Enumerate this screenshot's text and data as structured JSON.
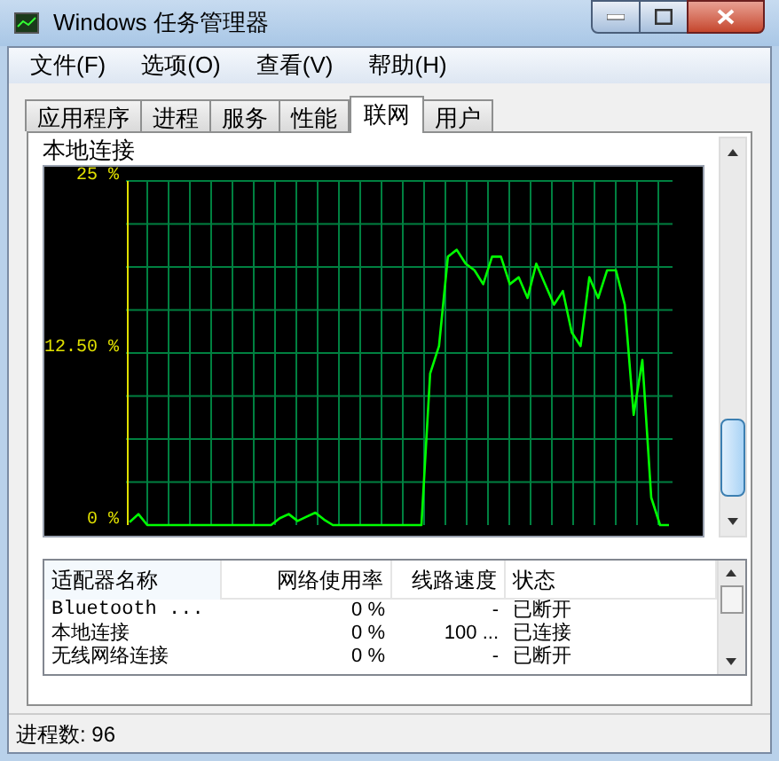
{
  "window": {
    "title": "Windows 任务管理器"
  },
  "menu": [
    "文件(F)",
    "选项(O)",
    "查看(V)",
    "帮助(H)"
  ],
  "tabs": [
    {
      "label": "应用程序",
      "selected": false
    },
    {
      "label": "进程",
      "selected": false
    },
    {
      "label": "服务",
      "selected": false
    },
    {
      "label": "性能",
      "selected": false
    },
    {
      "label": "联网",
      "selected": true
    },
    {
      "label": "用户",
      "selected": false
    }
  ],
  "graph": {
    "title": "本地连接",
    "chart_data": {
      "type": "line",
      "ylim": [
        0,
        25
      ],
      "yticks": [
        {
          "value": 0,
          "label": "0 %"
        },
        {
          "value": 12.5,
          "label": "12.50 %"
        },
        {
          "value": 25,
          "label": "25 %"
        }
      ],
      "grid": true,
      "series": [
        {
          "color": "#00ff00",
          "values": [
            0.2,
            0.8,
            0,
            0,
            0,
            0,
            0,
            0,
            0,
            0,
            0,
            0,
            0,
            0,
            0,
            0,
            0,
            0.5,
            0.8,
            0.3,
            0.6,
            0.9,
            0.4,
            0,
            0,
            0,
            0,
            0,
            0,
            0,
            0,
            0,
            0,
            0,
            11,
            13,
            19.5,
            20,
            19,
            18.5,
            17.5,
            19.5,
            19.5,
            17.5,
            18,
            16.5,
            19,
            17.5,
            16,
            17,
            14,
            13,
            18,
            16.5,
            18.5,
            18.5,
            16,
            8,
            12,
            2,
            0,
            0
          ]
        }
      ]
    }
  },
  "table": {
    "columns": [
      "适配器名称",
      "网络使用率",
      "线路速度",
      "状态"
    ],
    "rows": [
      {
        "cells": [
          "Bluetooth ...",
          "0 %",
          "-",
          "已断开"
        ]
      },
      {
        "cells": [
          "本地连接",
          "0 %",
          "100 ...",
          "已连接"
        ]
      },
      {
        "cells": [
          "无线网络连接",
          "0 %",
          "-",
          "已断开"
        ]
      }
    ]
  },
  "status_bar": [
    "进程数: 96"
  ]
}
